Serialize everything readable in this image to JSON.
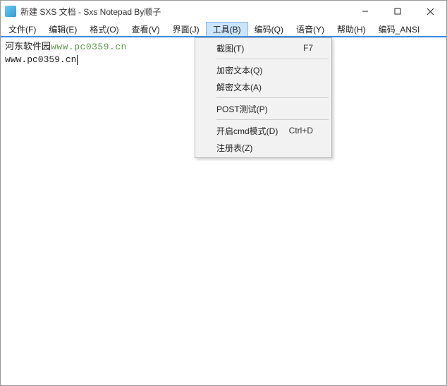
{
  "window": {
    "title": "新建 SXS 文档 - Sxs Notepad   By顺子"
  },
  "watermark_text": "河东软件园",
  "menubar": {
    "items": [
      {
        "label": "文件(F)"
      },
      {
        "label": "编辑(E)"
      },
      {
        "label": "格式(O)"
      },
      {
        "label": "查看(V)"
      },
      {
        "label": "界面(J)"
      },
      {
        "label": "工具(B)",
        "active": true
      },
      {
        "label": "编码(Q)"
      },
      {
        "label": "语音(Y)"
      },
      {
        "label": "帮助(H)"
      },
      {
        "label": "编码_ANSI"
      }
    ]
  },
  "dropdown": {
    "items": [
      {
        "label": "截图(T)",
        "shortcut": "F7"
      },
      {
        "sep": true
      },
      {
        "label": "加密文本(Q)"
      },
      {
        "label": "解密文本(A)"
      },
      {
        "sep": true
      },
      {
        "label": "POST测试(P)"
      },
      {
        "sep": true
      },
      {
        "label": "开启cmd模式(D)",
        "shortcut": "Ctrl+D"
      },
      {
        "label": "注册表(Z)"
      }
    ]
  },
  "editor": {
    "line1_left": "河东软件园",
    "line1_url": "www.pc0359.cn",
    "line2": "www.pc0359.cn"
  }
}
